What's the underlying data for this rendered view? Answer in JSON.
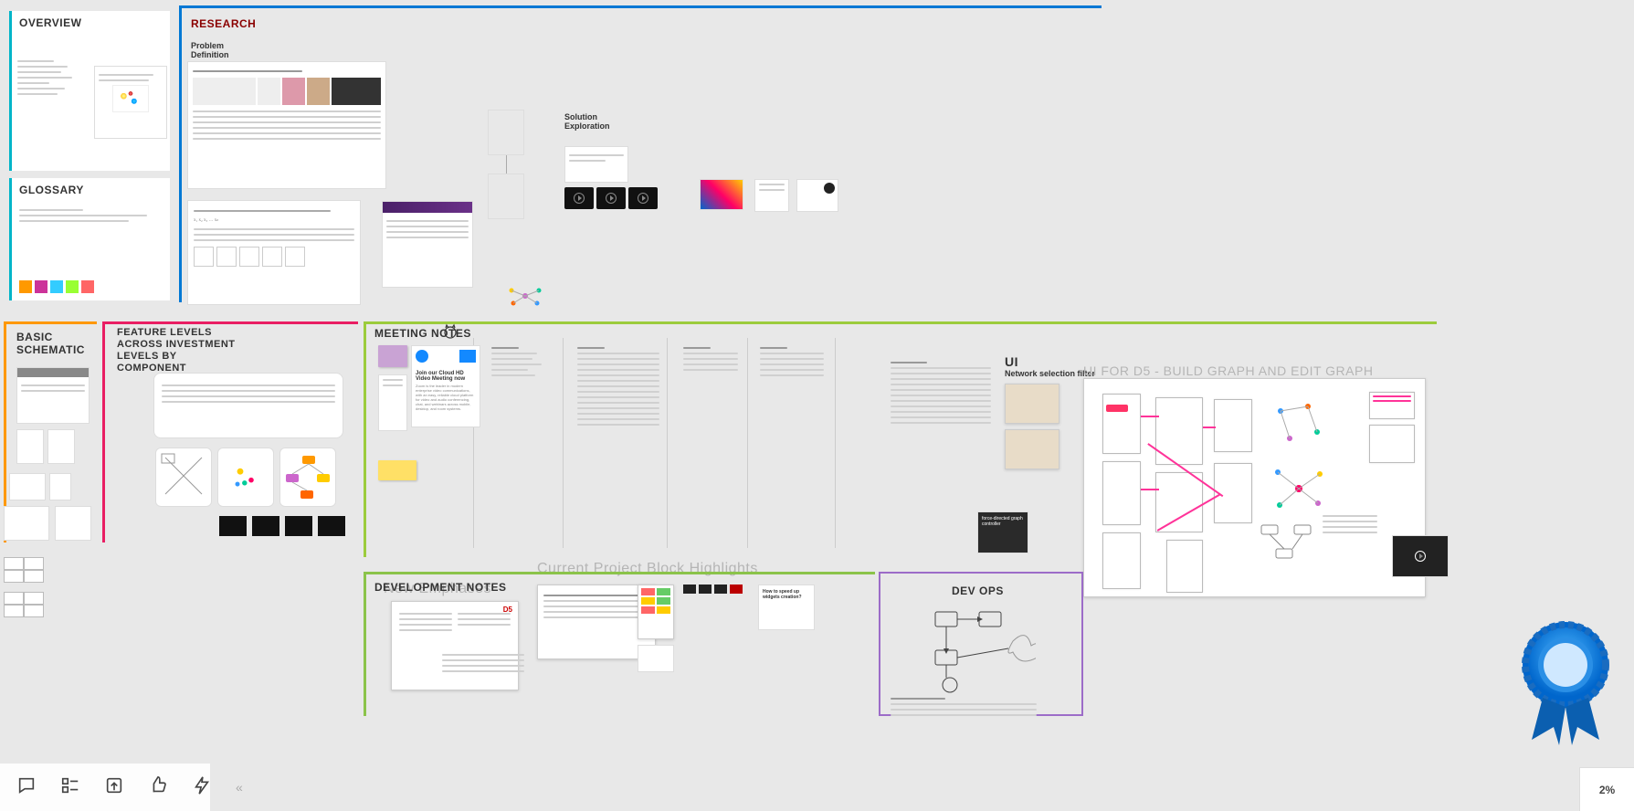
{
  "overview": {
    "title": "OVERVIEW"
  },
  "glossary": {
    "title": "GLOSSARY"
  },
  "research": {
    "title": "RESEARCH",
    "problem": "Problem",
    "definition": "Definition",
    "solution": "Solution",
    "exploration": "Exploration"
  },
  "basic": {
    "title": "BASIC SCHEMATIC"
  },
  "feature": {
    "title": "FEATURE LEVELS ACROSS INVESTMENT LEVELS BY COMPONENT"
  },
  "meeting": {
    "title": "MEETING NOTES",
    "invite_title": "Join our Cloud HD Video Meeting now",
    "invite_body": "Zoom is the leader in modern enterprise video communications, with an easy, reliable cloud platform for video and audio conferencing, chat, and webinars across mobile, desktop, and room systems."
  },
  "ui": {
    "title": "UI",
    "subtitle": "Network selection filter",
    "d5": "UI FOR D5 - BUILD GRAPH AND EDIT GRAPH",
    "caption": "force-directed graph controller"
  },
  "dev": {
    "title": "DEVELOPMENT NOTES",
    "d5": "D5"
  },
  "devops": {
    "title": "DEV OPS"
  },
  "overlay1": "Current Project Block Highlights",
  "overlay2": "New Emphases",
  "widgets": "How to speed up widgets creation?",
  "zoom": "2%"
}
